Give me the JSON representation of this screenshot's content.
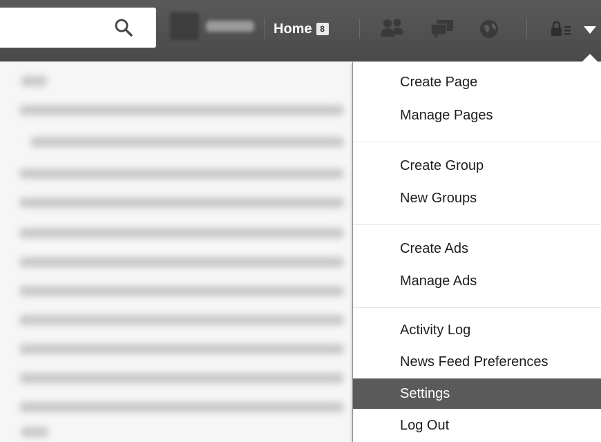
{
  "header": {
    "search": {
      "placeholder": "",
      "icon": "search-icon"
    },
    "home": {
      "label": "Home",
      "badge": "8"
    },
    "icons": [
      "friend-requests-icon",
      "messages-icon",
      "notifications-icon",
      "privacy-shortcuts-icon",
      "account-menu-chevron-icon"
    ],
    "colors": {
      "bar": "#4f4f4f",
      "active_item": "#5a5a5a"
    }
  },
  "menu": {
    "groups": [
      [
        "Create Page",
        "Manage Pages"
      ],
      [
        "Create Group",
        "New Groups"
      ],
      [
        "Create Ads",
        "Manage Ads"
      ],
      [
        "Activity Log",
        "News Feed Preferences",
        "Settings",
        "Log Out"
      ]
    ],
    "active": "Settings"
  }
}
